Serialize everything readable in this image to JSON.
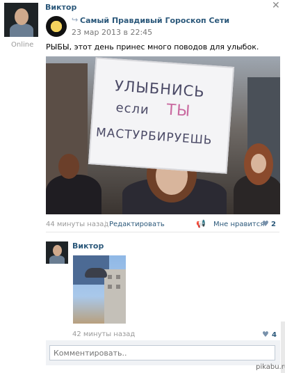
{
  "post": {
    "author": {
      "name": "Виктор",
      "status": "Online"
    },
    "repost": {
      "group_name": "Самый Правдивый Гороскоп Сети",
      "date": "23 мар 2013 в 22:45",
      "text": "РЫБЫ, этот день принес много поводов для улыбок."
    },
    "photo_sign": {
      "line1": "УЛЫБНИСЬ",
      "line2a": "если",
      "line2b": "ТЫ",
      "line3": "МАСТУРБИРУЕШЬ"
    },
    "meta": {
      "time": "44 минуты назад",
      "separator": "|",
      "edit": "Редактировать",
      "like_label": "Мне нравится",
      "like_count": "2"
    }
  },
  "comment": {
    "author": "Виктор",
    "time": "42 минуты назад",
    "like_count": "4"
  },
  "comment_form": {
    "placeholder": "Комментировать.."
  },
  "watermark": "pikabu.ru",
  "icons": {
    "close": "close-icon",
    "repost": "repost-icon",
    "megaphone": "megaphone-icon",
    "heart": "heart-icon"
  }
}
